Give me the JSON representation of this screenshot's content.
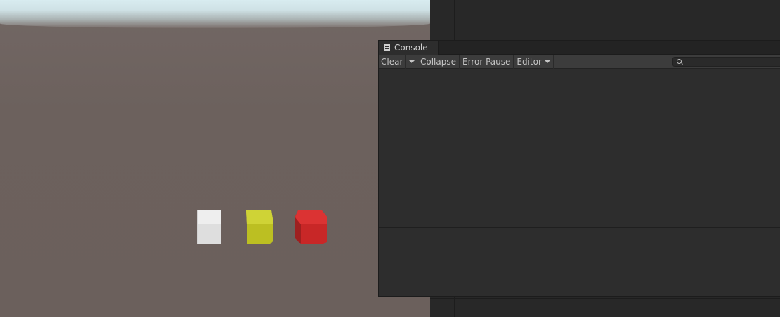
{
  "console": {
    "tab_label": "Console",
    "toolbar": {
      "clear_label": "Clear",
      "collapse_label": "Collapse",
      "error_pause_label": "Error Pause",
      "editor_label": "Editor"
    },
    "search": {
      "placeholder": "",
      "value": ""
    },
    "log_entries": [],
    "detail_text": ""
  },
  "scene": {
    "objects": [
      {
        "name": "white-cube",
        "color": "#e6e6e6"
      },
      {
        "name": "yellow-cube",
        "color": "#c9cd2e"
      },
      {
        "name": "red-cube",
        "color": "#d83232"
      }
    ]
  }
}
